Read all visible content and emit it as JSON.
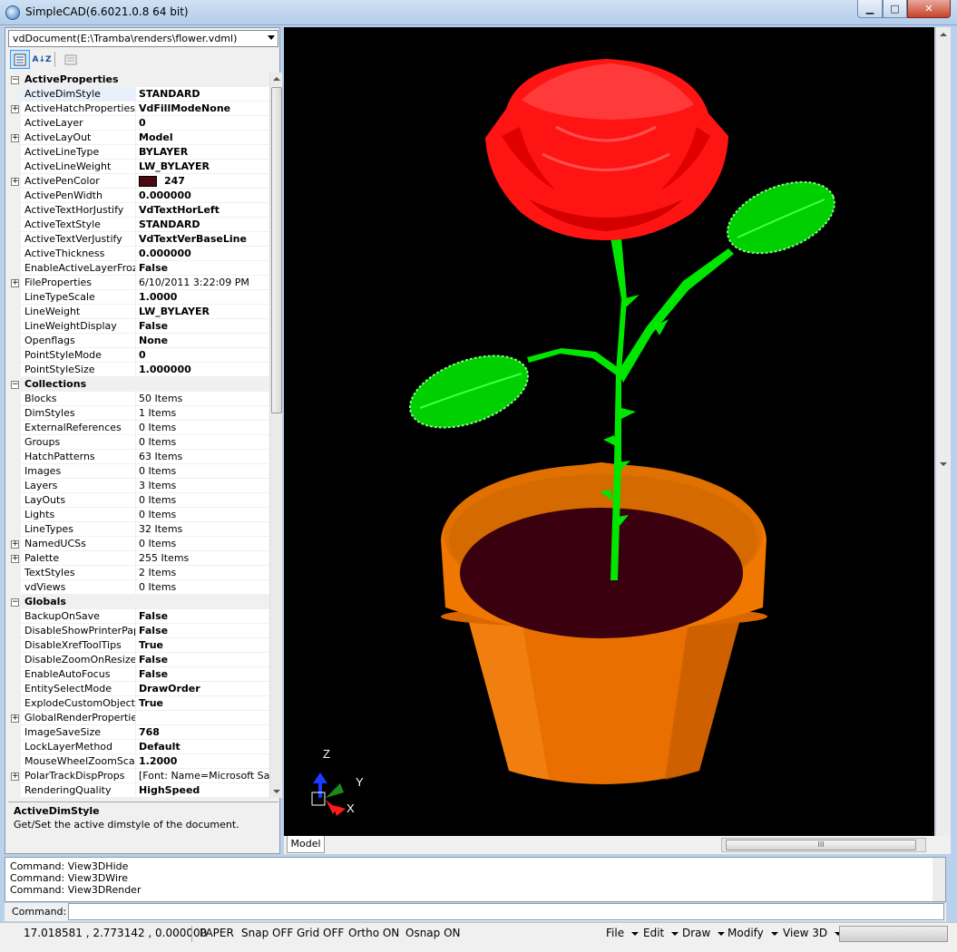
{
  "window": {
    "title": "SimpleCAD(6.6021.0.8  64 bit)",
    "min_icon": "minimize-icon",
    "max_icon": "maximize-icon",
    "close_icon": "close-icon"
  },
  "document_selector": {
    "value": "vdDocument(E:\\Tramba\\renders\\flower.vdml)"
  },
  "toolbar": {
    "categorized_icon": "categorized-icon",
    "alphabetical_icon": "alphabetical-icon",
    "alphabetical_label": "A↓Z",
    "pages_icon": "property-pages-icon"
  },
  "properties": {
    "active_properties": {
      "header": "ActiveProperties",
      "rows": [
        {
          "name": "ActiveDimStyle",
          "value": "STANDARD"
        },
        {
          "name": "ActiveHatchProperties",
          "value": "VdFillModeNone"
        },
        {
          "name": "ActiveLayer",
          "value": "0"
        },
        {
          "name": "ActiveLayOut",
          "value": "Model"
        },
        {
          "name": "ActiveLineType",
          "value": "BYLAYER"
        },
        {
          "name": "ActiveLineWeight",
          "value": "LW_BYLAYER"
        },
        {
          "name": "ActivePenColor",
          "value": "247"
        },
        {
          "name": "ActivePenWidth",
          "value": "0.000000"
        },
        {
          "name": "ActiveTextHorJustify",
          "value": "VdTextHorLeft"
        },
        {
          "name": "ActiveTextStyle",
          "value": "STANDARD"
        },
        {
          "name": "ActiveTextVerJustify",
          "value": "VdTextVerBaseLine"
        },
        {
          "name": "ActiveThickness",
          "value": "0.000000"
        },
        {
          "name": "EnableActiveLayerFrozen",
          "value": "False"
        },
        {
          "name": "FileProperties",
          "value": "6/10/2011 3:22:09 PM"
        },
        {
          "name": "LineTypeScale",
          "value": "1.0000"
        },
        {
          "name": "LineWeight",
          "value": "LW_BYLAYER"
        },
        {
          "name": "LineWeightDisplay",
          "value": "False"
        },
        {
          "name": "Openflags",
          "value": "None"
        },
        {
          "name": "PointStyleMode",
          "value": "0"
        },
        {
          "name": "PointStyleSize",
          "value": "1.000000"
        }
      ]
    },
    "collections": {
      "header": "Collections",
      "rows": [
        {
          "name": "Blocks",
          "value": "50 Items"
        },
        {
          "name": "DimStyles",
          "value": "1 Items"
        },
        {
          "name": "ExternalReferences",
          "value": "0 Items"
        },
        {
          "name": "Groups",
          "value": "0 Items"
        },
        {
          "name": "HatchPatterns",
          "value": "63 Items"
        },
        {
          "name": "Images",
          "value": "0 Items"
        },
        {
          "name": "Layers",
          "value": "3 Items"
        },
        {
          "name": "LayOuts",
          "value": "0 Items"
        },
        {
          "name": "Lights",
          "value": "0 Items"
        },
        {
          "name": "LineTypes",
          "value": "32 Items"
        },
        {
          "name": "NamedUCSs",
          "value": "0 Items"
        },
        {
          "name": "Palette",
          "value": "255 Items"
        },
        {
          "name": "TextStyles",
          "value": "2 Items"
        },
        {
          "name": "vdViews",
          "value": "0 Items"
        }
      ]
    },
    "globals": {
      "header": "Globals",
      "rows": [
        {
          "name": "BackupOnSave",
          "value": "False"
        },
        {
          "name": "DisableShowPrinterPaper",
          "value": "False"
        },
        {
          "name": "DisableXrefToolTips",
          "value": "True"
        },
        {
          "name": "DisableZoomOnResize",
          "value": "False"
        },
        {
          "name": "EnableAutoFocus",
          "value": "False"
        },
        {
          "name": "EntitySelectMode",
          "value": "DrawOrder"
        },
        {
          "name": "ExplodeCustomObjectsOr",
          "value": "True"
        },
        {
          "name": "GlobalRenderProperties",
          "value": ""
        },
        {
          "name": "ImageSaveSize",
          "value": "768"
        },
        {
          "name": "LockLayerMethod",
          "value": "Default"
        },
        {
          "name": "MouseWheelZoomScale",
          "value": "1.2000"
        },
        {
          "name": "PolarTrackDispProps",
          "value": "[Font: Name=Microsoft Sans"
        },
        {
          "name": "RenderingQuality",
          "value": "HighSpeed"
        }
      ]
    }
  },
  "help": {
    "title": "ActiveDimStyle",
    "description": "Get/Set the active dimstyle of the document."
  },
  "pen_color": "#4a0a12",
  "viewport": {
    "axis_labels": {
      "z": "Z",
      "y": "Y",
      "x": "X"
    },
    "colors": {
      "background": "#000000",
      "petals": "#ff1a1a",
      "stem": "#00e600",
      "pot": "#f07800",
      "soil": "#3a0010"
    }
  },
  "tabs": {
    "model": "Model"
  },
  "hscroll_grip": "III",
  "command_history": [
    "Command: View3DHide",
    "Command: View3DWire",
    "Command: View3DRender"
  ],
  "command_label": "Command:",
  "status": {
    "coords": "17.018581 , 2.773142 , 0.000000",
    "paper": "PAPER",
    "snap": "Snap OFF",
    "grid": "Grid OFF",
    "ortho": "Ortho ON",
    "osnap": "Osnap ON",
    "menus": [
      "File",
      "Edit",
      "Draw",
      "Modify",
      "View 3D"
    ]
  }
}
